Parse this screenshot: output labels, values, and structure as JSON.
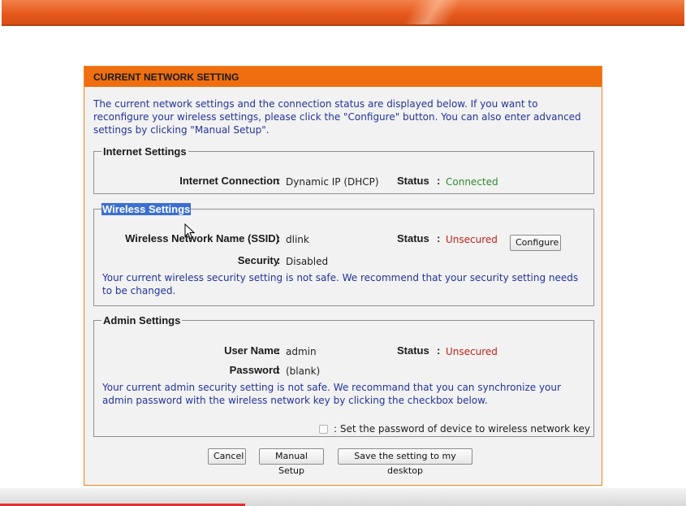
{
  "panel": {
    "title": "CURRENT NETWORK SETTING",
    "intro": "The current network settings and the connection status are displayed below. If you want to reconfigure your wireless settings, please click the \"Configure\" button. You can also enter advanced settings by clicking \"Manual Setup\"."
  },
  "internet": {
    "legend": "Internet Settings",
    "connection_label": "Internet Connection",
    "connection_value": "Dynamic IP (DHCP)",
    "status_label": "Status",
    "status_value": "Connected"
  },
  "wireless": {
    "legend": "Wireless Settings",
    "ssid_label": "Wireless Network Name (SSID)",
    "ssid_value": "dlink",
    "status_label": "Status",
    "status_value": "Unsecured",
    "configure_button": "Configure",
    "security_label": "Security",
    "security_value": "Disabled",
    "warning": "Your current wireless security setting is not safe. We recommend that your security setting needs to be changed."
  },
  "admin": {
    "legend": "Admin Settings",
    "username_label": "User Name",
    "username_value": "admin",
    "status_label": "Status",
    "status_value": "Unsecured",
    "password_label": "Password",
    "password_value": "(blank)",
    "warning": "Your current admin security setting is not safe. We recommand that you can synchronize your admin password with the wireless network key by clicking the checkbox below.",
    "sync_checkbox_label": ": Set the password of device to wireless network key"
  },
  "buttons": {
    "cancel": "Cancel",
    "manual_setup": "Manual Setup",
    "save_desktop": "Save the setting to my desktop"
  },
  "colors": {
    "accent": "#ef6f10",
    "status_ok": "#2f8a2f",
    "status_bad": "#c0201a",
    "info_text": "#23339a"
  }
}
